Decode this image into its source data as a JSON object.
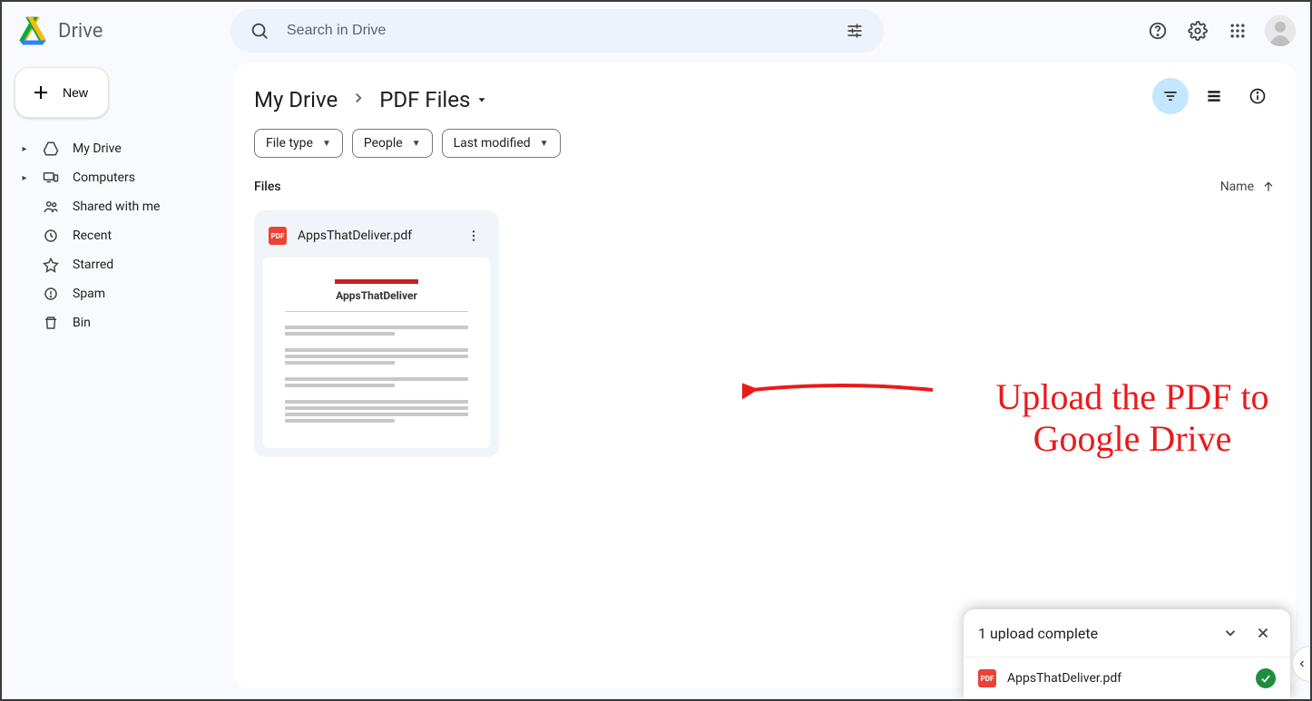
{
  "product": {
    "name": "Drive"
  },
  "search": {
    "placeholder": "Search in Drive"
  },
  "new_button": "New",
  "sidebar": {
    "items": [
      {
        "label": "My Drive",
        "icon": "drive",
        "expandable": true
      },
      {
        "label": "Computers",
        "icon": "devices",
        "expandable": true
      },
      {
        "label": "Shared with me",
        "icon": "people"
      },
      {
        "label": "Recent",
        "icon": "clock"
      },
      {
        "label": "Starred",
        "icon": "star"
      },
      {
        "label": "Spam",
        "icon": "spam"
      },
      {
        "label": "Bin",
        "icon": "trash"
      }
    ]
  },
  "breadcrumbs": {
    "root": "My Drive",
    "current": "PDF Files"
  },
  "filters": {
    "type": "File type",
    "people": "People",
    "modified": "Last modified"
  },
  "section": {
    "label": "Files",
    "sort": "Name"
  },
  "files": [
    {
      "name": "AppsThatDeliver.pdf",
      "thumb_title": "AppsThatDeliver"
    }
  ],
  "annotation": {
    "line1": "Upload the PDF to",
    "line2": "Google Drive"
  },
  "toast": {
    "title": "1 upload complete",
    "item_name": "AppsThatDeliver.pdf"
  }
}
